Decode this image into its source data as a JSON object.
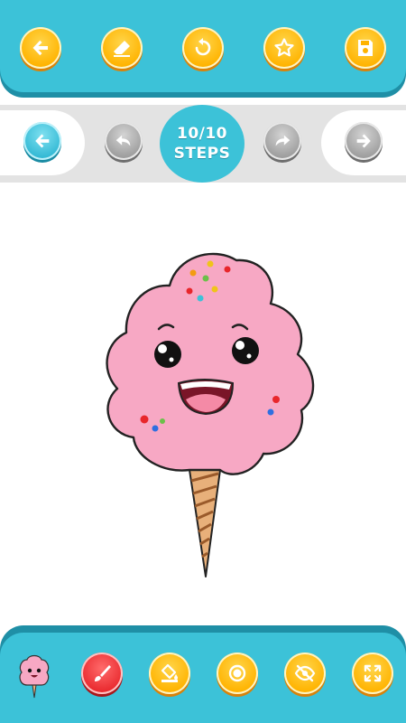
{
  "toolbar_top": {
    "buttons": [
      "back-arrow-icon",
      "eraser-icon",
      "undo-icon",
      "star-icon",
      "save-icon"
    ]
  },
  "step_nav": {
    "progress": "10/10",
    "steps_label": "STEPS",
    "current_step": 10,
    "total_steps": 10
  },
  "toolbar_bottom": {
    "buttons": [
      "brush-icon",
      "fill-bucket-icon",
      "circle-icon",
      "hide-icon",
      "fullscreen-icon"
    ]
  },
  "colors": {
    "accent": "#3cc2d8",
    "accent_dark": "#1f8fa6",
    "button_orange": "#ffb300",
    "button_red": "#e8262b",
    "candy_pink": "#f7a8c4"
  }
}
